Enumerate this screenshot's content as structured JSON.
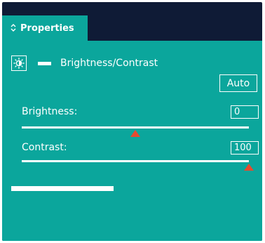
{
  "tab": {
    "chevron": "⌃⌄",
    "title": "Properties"
  },
  "adjustment": {
    "icon": "brightness-icon",
    "title": "Brightness/Contrast"
  },
  "auto_button": {
    "label": "Auto"
  },
  "brightness": {
    "label": "Brightness:",
    "value": "0",
    "level": 0.5
  },
  "contrast": {
    "label": "Contrast:",
    "value": "100",
    "level": 1.0
  },
  "colors": {
    "panel": "#0ba69c",
    "frame": "#0f1b36",
    "thumb": "#e64a2e"
  }
}
